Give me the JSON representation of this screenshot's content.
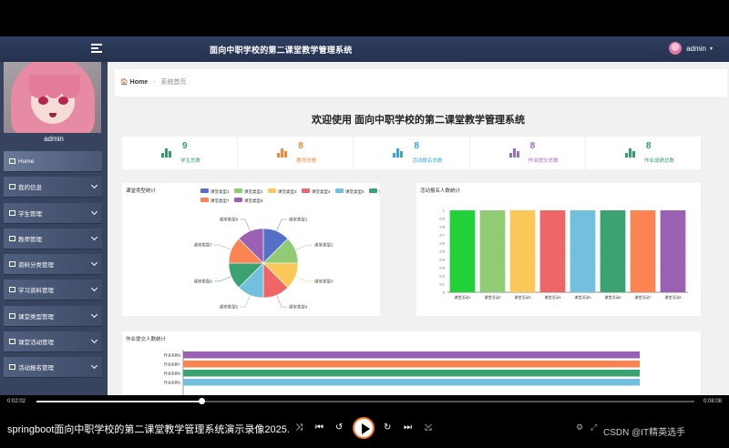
{
  "header": {
    "system_title": "面向中职学校的第二课堂教学管理系统",
    "user_name": "admin",
    "user_caret": "▾"
  },
  "sidebar": {
    "profile_name": "admin",
    "items": [
      {
        "label": "Home",
        "expandable": false,
        "active": true
      },
      {
        "label": "我的信息",
        "expandable": true
      },
      {
        "label": "学生管理",
        "expandable": true
      },
      {
        "label": "教师管理",
        "expandable": true
      },
      {
        "label": "资料分类管理",
        "expandable": true
      },
      {
        "label": "学习资料管理",
        "expandable": true
      },
      {
        "label": "课堂类型管理",
        "expandable": true
      },
      {
        "label": "课堂活动管理",
        "expandable": true
      },
      {
        "label": "活动报名管理",
        "expandable": true
      }
    ]
  },
  "breadcrumb": {
    "home": "Home",
    "separator": "-",
    "current": "系统首页"
  },
  "welcome": "欢迎使用 面向中职学校的第二课堂教学管理系统",
  "stats": [
    {
      "value": "9",
      "label": "学生总数",
      "color": "#2f9e6a"
    },
    {
      "value": "8",
      "label": "教师总数",
      "color": "#ef8a3a"
    },
    {
      "value": "8",
      "label": "活动报名总数",
      "color": "#36a3d9"
    },
    {
      "value": "8",
      "label": "作业提交总数",
      "color": "#9b6cc4"
    },
    {
      "value": "8",
      "label": "作业成绩总数",
      "color": "#2f9e6a"
    }
  ],
  "chart_data": [
    {
      "type": "pie",
      "title": "课堂类型统计",
      "categories": [
        "课堂类型1",
        "课堂类型2",
        "课堂类型3",
        "课堂类型4",
        "课堂类型5",
        "课堂类型6",
        "课堂类型7",
        "课堂类型8"
      ],
      "values": [
        1,
        1,
        1,
        1,
        1,
        1,
        1,
        1
      ],
      "colors": [
        "#5470c6",
        "#91cc75",
        "#fac858",
        "#ee6666",
        "#73c0de",
        "#3ba272",
        "#fc8452",
        "#9a60b4"
      ],
      "legend": "top"
    },
    {
      "type": "bar",
      "title": "活动报名人数统计",
      "categories": [
        "课堂活动1",
        "课堂活动2",
        "课堂活动3",
        "课堂活动4",
        "课堂活动5",
        "课堂活动6",
        "课堂活动7",
        "课堂活动8"
      ],
      "values": [
        1,
        1,
        1,
        1,
        1,
        1,
        1,
        1
      ],
      "colors": [
        "#22d13a",
        "#91cc75",
        "#fac858",
        "#ee6666",
        "#73c0de",
        "#3ba272",
        "#fc8452",
        "#9a60b4"
      ],
      "ylim": [
        0,
        1
      ],
      "yticks": [
        "0",
        "0.1",
        "0.2",
        "0.3",
        "0.4",
        "0.5",
        "0.6",
        "0.7",
        "0.8",
        "0.9",
        "1"
      ],
      "grid": true
    },
    {
      "type": "bar",
      "orientation": "horizontal",
      "title": "作业提交人数统计",
      "categories": [
        "作业名称8",
        "作业名称7",
        "作业名称6",
        "作业名称5"
      ],
      "values": [
        1,
        1,
        1,
        1
      ],
      "colors": [
        "#9a60b4",
        "#fc8452",
        "#3ba272",
        "#73c0de"
      ]
    }
  ],
  "player": {
    "current_time": "0:02:02",
    "total_time": "0:08:08",
    "progress": 0.25,
    "video_title": "springboot面向中职学校的第二课堂教学管理系统演示录像2025...",
    "controls": [
      "⤨",
      "⏮",
      "↺",
      "↻",
      "⏭",
      "⤩"
    ],
    "watermark": "CSDN @IT精英选手",
    "right_icons": [
      "⚙",
      "⤢"
    ]
  }
}
